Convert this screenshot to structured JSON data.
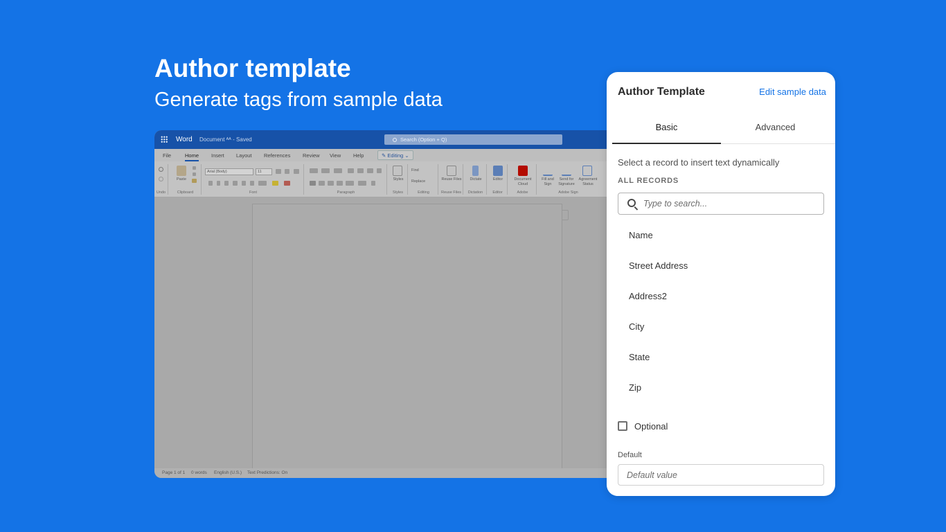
{
  "hero": {
    "title": "Author template",
    "subtitle": "Generate tags from sample data"
  },
  "word": {
    "app_name": "Word",
    "document_name": "Document ᴬᴬ - Saved",
    "search_placeholder": "Search (Option + Q)",
    "menu": [
      "File",
      "Home",
      "Insert",
      "Layout",
      "References",
      "Review",
      "View",
      "Help"
    ],
    "active_menu": "Home",
    "editing_label": "✎ Editing ⌄",
    "ribbon": {
      "font_name": "Arial (Body)",
      "font_size": "11",
      "groups": [
        "Undo",
        "Clipboard",
        "Font",
        "Paragraph",
        "Styles",
        "Editing",
        "Reuse Files",
        "Dictation",
        "Editor",
        "Adobe",
        "Adobe Sign"
      ],
      "paste": "Paste",
      "styles": "Styles",
      "find": "Find",
      "replace": "Replace",
      "reuse_files": "Reuse Files",
      "dictate": "Dictate",
      "editor": "Editor",
      "document_cloud": "Document Cloud",
      "fill_sign": "Fill and Sign",
      "send_signature": "Send for Signature",
      "agreement_status": "Agreement Status"
    },
    "status": {
      "page": "Page 1 of 1",
      "words": "0 words",
      "language": "English (U.S.)",
      "predictions": "Text Predictions: On"
    }
  },
  "panel": {
    "title": "Author Template",
    "edit_link": "Edit sample data",
    "tabs": [
      "Basic",
      "Advanced"
    ],
    "active_tab": "Basic",
    "instruction": "Select a record to insert text dynamically",
    "section_label": "ALL RECORDS",
    "search_placeholder": "Type to search...",
    "records": [
      "Name",
      "Street Address",
      "Address2",
      "City",
      "State",
      "Zip"
    ],
    "optional_label": "Optional",
    "optional_checked": false,
    "default_label": "Default",
    "default_placeholder": "Default value"
  },
  "colors": {
    "background": "#1473e6",
    "word_titlebar": "#1752a8",
    "link": "#1473e6",
    "acrobat_red": "#b30b00"
  }
}
